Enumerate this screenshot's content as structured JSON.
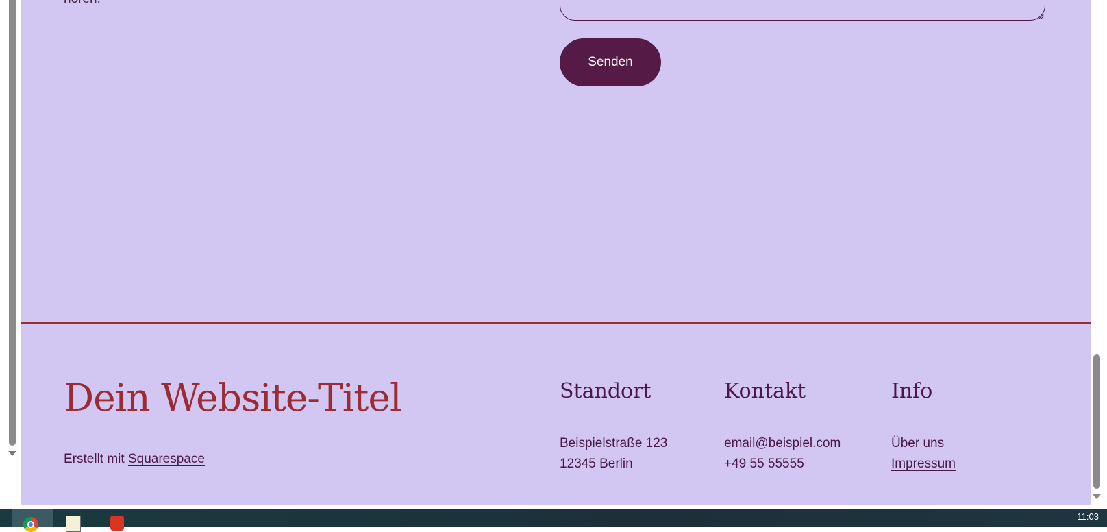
{
  "form": {
    "intro_text_fragment": "hören.",
    "send_label": "Senden"
  },
  "footer": {
    "site_title": "Dein Website-Titel",
    "built_with_prefix": "Erstellt mit",
    "built_with_link": "Squarespace",
    "columns": [
      {
        "heading": "Standort",
        "lines": [
          "Beispielstraße 123",
          "12345 Berlin"
        ]
      },
      {
        "heading": "Kontakt",
        "lines": [
          "email@beispiel.com",
          "+49 55 55555"
        ]
      },
      {
        "heading": "Info",
        "links": [
          "Über uns",
          "Impressum"
        ]
      }
    ]
  },
  "taskbar": {
    "apps": [
      "chrome-icon",
      "notepad-icon",
      "acrobat-icon"
    ],
    "clock": "11:03"
  },
  "colors": {
    "page_background": "#d2c7f2",
    "accent": "#9d2b33",
    "button": "#561a46",
    "text": "#4a1846"
  }
}
